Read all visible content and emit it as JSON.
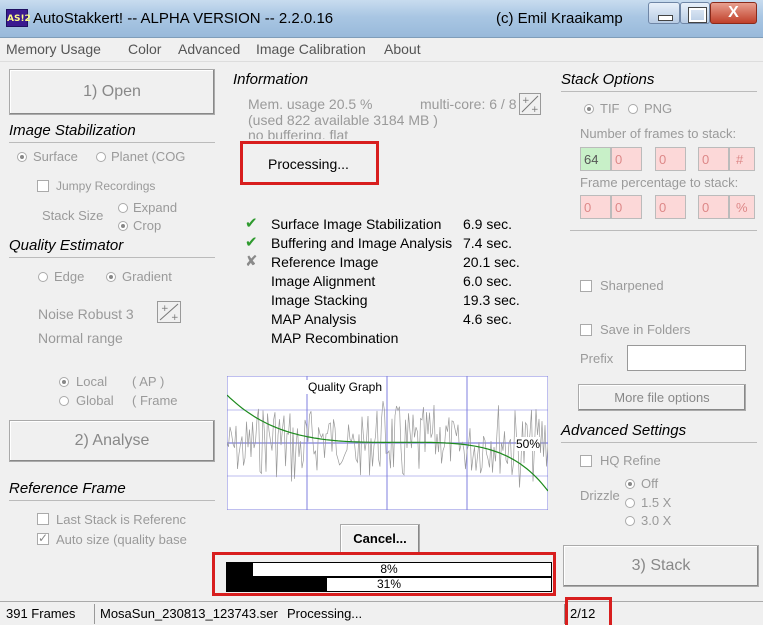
{
  "window": {
    "icon_text": "AS!2",
    "title": "AutoStakkert! -- ALPHA VERSION -- 2.2.0.16",
    "copyright": "(c) Emil Kraaikamp",
    "close_glyph": "X"
  },
  "menu": [
    "Memory Usage",
    "Color",
    "Advanced",
    "Image Calibration",
    "About"
  ],
  "left": {
    "open_button": "1) Open",
    "image_stab_title": "Image Stabilization",
    "surface_label": "Surface",
    "planet_label": "Planet (COG",
    "jumpy_label": "Jumpy Recordings",
    "stack_size_label": "Stack Size",
    "expand_label": "Expand",
    "crop_label": "Crop",
    "quality_title": "Quality Estimator",
    "edge_label": "Edge",
    "gradient_label": "Gradient",
    "noise_label": "Noise Robust 3",
    "normal_range_label": "Normal range",
    "local_label": "Local",
    "local_ap": "( AP )",
    "global_label": "Global",
    "global_frame": "( Frame",
    "analyse_button": "2) Analyse",
    "ref_frame_title": "Reference Frame",
    "last_stack_label": "Last Stack is Referenc",
    "auto_size_label": "Auto size (quality base"
  },
  "center": {
    "info_title": "Information",
    "mem_usage": "Mem. usage 20.5 %",
    "multicore": "multi-core: 6 / 8",
    "used_line": "(used 822 available 3184 MB )",
    "buffering_line": "no buffering, flat",
    "processing_label": "Processing...",
    "steps": [
      {
        "mark": "✔",
        "mark_color": "#2e9a2e",
        "name": "Surface Image Stabilization",
        "time": "6.9 sec."
      },
      {
        "mark": "✔",
        "mark_color": "#2e9a2e",
        "name": "Buffering and Image Analysis",
        "time": "7.4 sec."
      },
      {
        "mark": "✘",
        "mark_color": "#8a8a8a",
        "name": "Reference Image",
        "time": "20.1 sec."
      },
      {
        "mark": "",
        "mark_color": "#000",
        "name": "Image Alignment",
        "time": "6.0 sec."
      },
      {
        "mark": "",
        "mark_color": "#000",
        "name": "Image Stacking",
        "time": "19.3 sec."
      },
      {
        "mark": "",
        "mark_color": "#000",
        "name": "MAP Analysis",
        "time": "4.6 sec."
      },
      {
        "mark": "",
        "mark_color": "#000",
        "name": "MAP Recombination",
        "time": ""
      }
    ],
    "graph_title": "Quality Graph",
    "graph_50": "50%",
    "cancel_button": "Cancel...",
    "progress1_label": "8%",
    "progress1_value": 8,
    "progress2_label": "31%",
    "progress2_value": 31
  },
  "right": {
    "stack_options_title": "Stack Options",
    "tif_label": "TIF",
    "png_label": "PNG",
    "num_frames_label": "Number of frames to stack:",
    "frames_values": [
      "64",
      "0",
      "0",
      "0"
    ],
    "frames_suffix": "#",
    "percentage_label": "Frame percentage to stack:",
    "percentage_values": [
      "0",
      "0",
      "0",
      "0"
    ],
    "percentage_suffix": "%",
    "sharpened_label": "Sharpened",
    "save_folders_label": "Save in Folders",
    "prefix_label": "Prefix",
    "more_file_button": "More file options",
    "advanced_title": "Advanced Settings",
    "hq_refine_label": "HQ Refine",
    "drizzle_label": "Drizzle",
    "drizzle_off": "Off",
    "drizzle_15": "1.5 X",
    "drizzle_30": "3.0 X",
    "stack_button": "3) Stack"
  },
  "status": {
    "frames": "391 Frames",
    "file": "MosaSun_230813_123743.ser",
    "state": "Processing...",
    "page": "2/12"
  },
  "colors": {
    "highlight_red": "#d81e1e",
    "graph_blue": "#7f7fdf",
    "graph_green": "#1c8a1c"
  }
}
